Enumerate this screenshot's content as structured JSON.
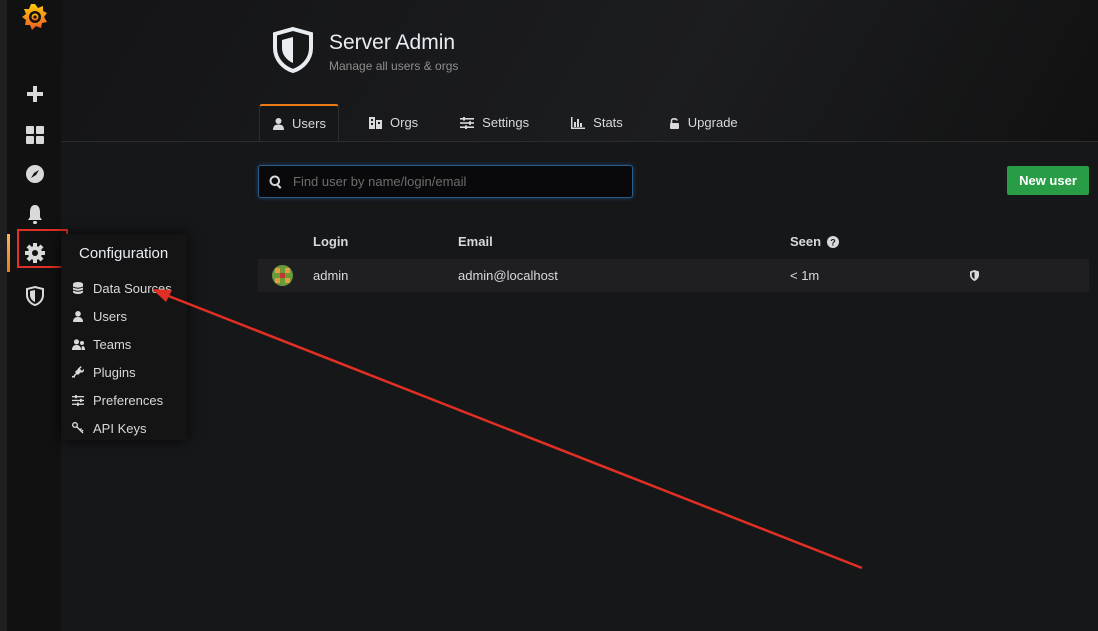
{
  "header": {
    "title": "Server Admin",
    "subtitle": "Manage all users & orgs"
  },
  "tabs": [
    {
      "label": "Users",
      "icon": "user-icon",
      "active": true
    },
    {
      "label": "Orgs",
      "icon": "building-icon"
    },
    {
      "label": "Settings",
      "icon": "sliders-icon"
    },
    {
      "label": "Stats",
      "icon": "bar-chart-icon"
    },
    {
      "label": "Upgrade",
      "icon": "unlock-icon"
    }
  ],
  "search": {
    "placeholder": "Find user by name/login/email",
    "value": ""
  },
  "new_user_label": "New user",
  "table": {
    "columns": [
      "Login",
      "Email",
      "Seen"
    ],
    "rows": [
      {
        "login": "admin",
        "email": "admin@localhost",
        "seen": "< 1m"
      }
    ]
  },
  "config_menu": {
    "title": "Configuration",
    "items": [
      {
        "label": "Data Sources",
        "icon": "database-icon"
      },
      {
        "label": "Users",
        "icon": "user-icon"
      },
      {
        "label": "Teams",
        "icon": "users-icon"
      },
      {
        "label": "Plugins",
        "icon": "plug-icon"
      },
      {
        "label": "Preferences",
        "icon": "sliders-icon"
      },
      {
        "label": "API Keys",
        "icon": "key-icon"
      }
    ]
  },
  "colors": {
    "accent": "#eb7b18",
    "primary_button": "#299c46",
    "annotation": "#e02f24"
  }
}
